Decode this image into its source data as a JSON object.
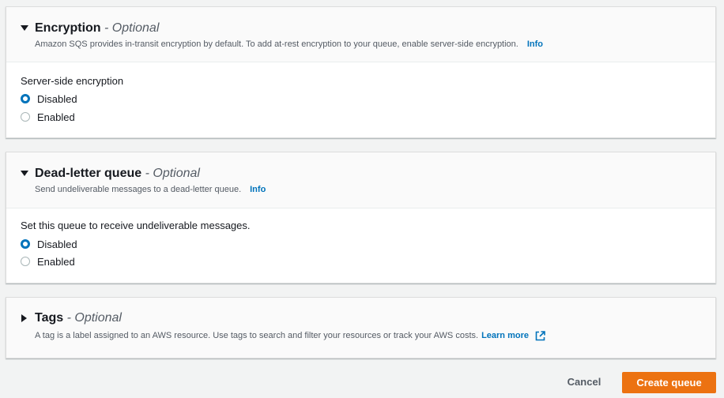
{
  "encryption": {
    "title": "Encryption",
    "optional": "- Optional",
    "description": "Amazon SQS provides in-transit encryption by default. To add at-rest encryption to your queue, enable server-side encryption.",
    "info": "Info",
    "field_label": "Server-side encryption",
    "options": [
      {
        "label": "Disabled",
        "selected": true
      },
      {
        "label": "Enabled",
        "selected": false
      }
    ]
  },
  "dead_letter": {
    "title": "Dead-letter queue",
    "optional": "- Optional",
    "description": "Send undeliverable messages to a dead-letter queue.",
    "info": "Info",
    "field_label": "Set this queue to receive undeliverable messages.",
    "options": [
      {
        "label": "Disabled",
        "selected": true
      },
      {
        "label": "Enabled",
        "selected": false
      }
    ]
  },
  "tags": {
    "title": "Tags",
    "optional": "- Optional",
    "description": "A tag is a label assigned to an AWS resource. Use tags to search and filter your resources or track your AWS costs.",
    "learn_more": "Learn more",
    "icon": "external-link-icon"
  },
  "footer": {
    "cancel": "Cancel",
    "create": "Create queue"
  },
  "colors": {
    "accent_link": "#0073bb",
    "primary_button": "#ec7211",
    "radio_selected": "#0073bb"
  }
}
